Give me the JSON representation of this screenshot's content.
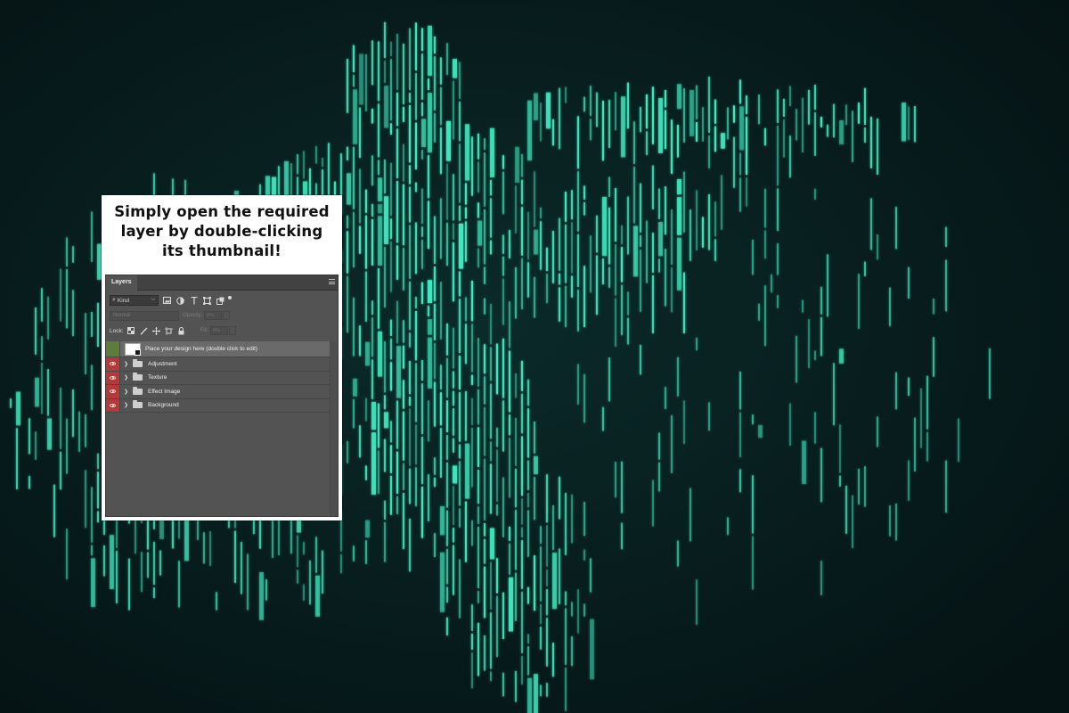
{
  "colors": {
    "background": "#06191a",
    "glyph": "#3fe6bd",
    "visibility_on": "#b3393b",
    "visibility_selected": "#5e7d3b"
  },
  "card": {
    "title_line1": "Simply open the required",
    "title_line2": "layer by double-clicking",
    "title_line3": "its thumbnail!"
  },
  "layers_panel": {
    "tab": "Layers",
    "filter": {
      "kind": "Kind"
    },
    "blend_mode": "Normal",
    "opacity_label": "Opacity:",
    "opacity_value": "0%",
    "lock_label": "Lock:",
    "fill_label": "Fill:",
    "fill_value": "0%",
    "layers": [
      {
        "name": "Place your design here (double click to edit)",
        "type": "smart-object",
        "selected": true
      },
      {
        "name": "Adjustment",
        "type": "group"
      },
      {
        "name": "Texture",
        "type": "group"
      },
      {
        "name": "Effect Image",
        "type": "group"
      },
      {
        "name": "Background",
        "type": "group"
      }
    ]
  }
}
